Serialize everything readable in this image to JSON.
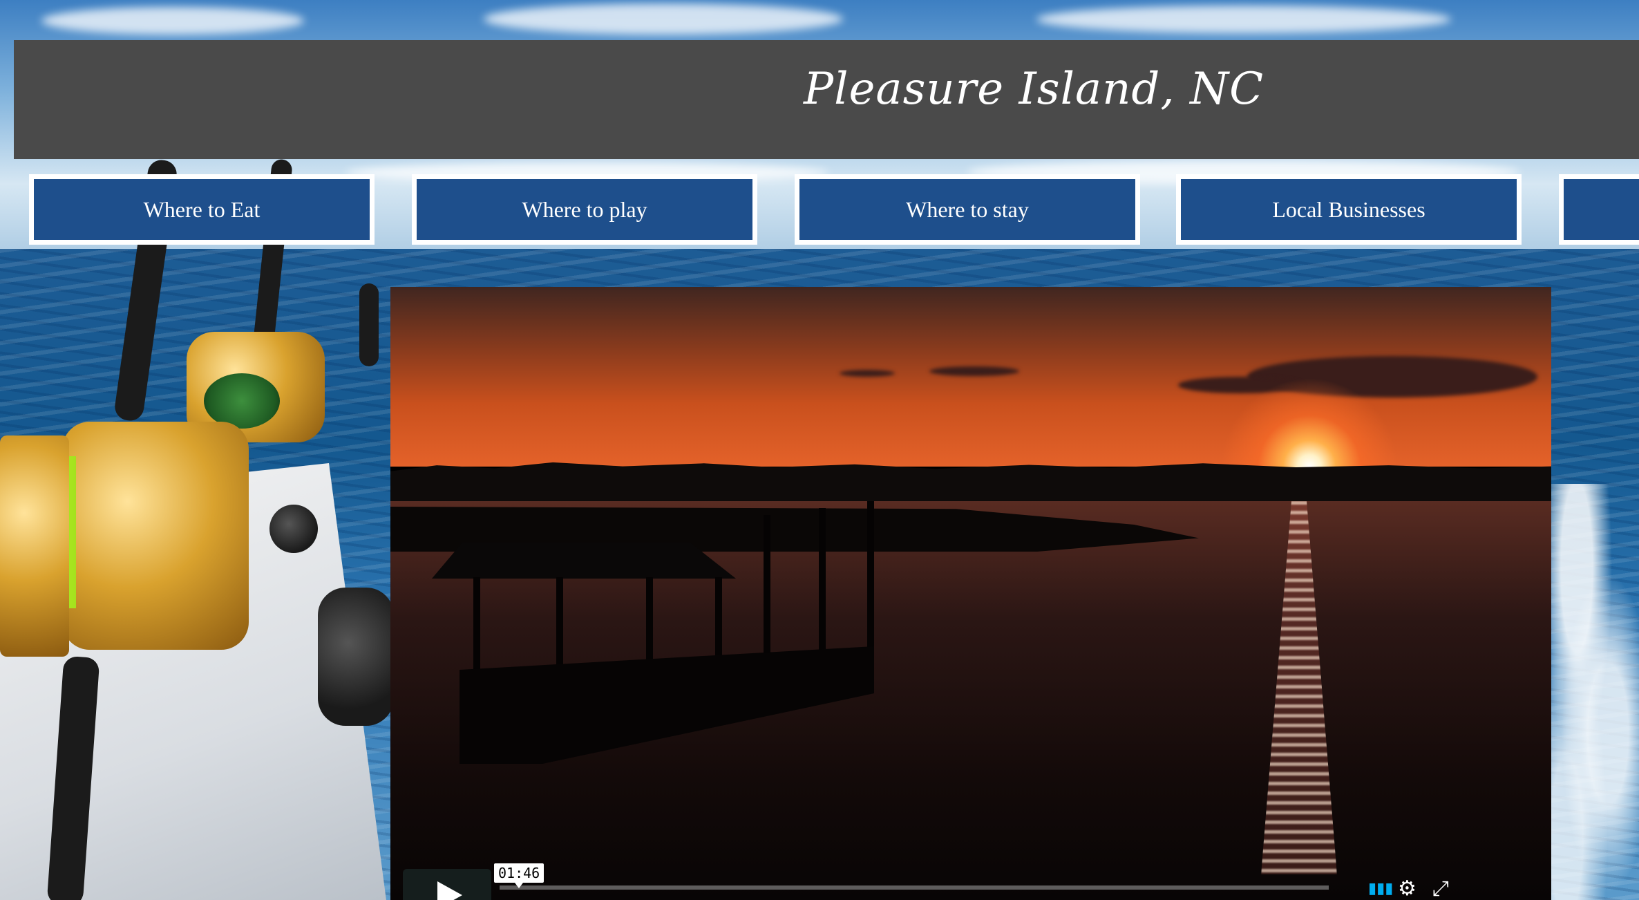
{
  "header": {
    "title": "Pleasure Island, NC"
  },
  "nav": {
    "items": [
      {
        "label": "Where to Eat"
      },
      {
        "label": "Where to play"
      },
      {
        "label": "Where to stay"
      },
      {
        "label": "Local Businesses"
      },
      {
        "label": ""
      }
    ]
  },
  "video": {
    "timecode": "01:46",
    "icons": {
      "play": "play-icon",
      "volume": "volume-icon",
      "settings": "gear-icon",
      "fullscreen": "fullscreen-icon"
    }
  },
  "colors": {
    "header_bg": "#4a4a4a",
    "nav_bg": "#1e4f8c",
    "nav_border": "#ffffff",
    "text": "#ffffff"
  }
}
